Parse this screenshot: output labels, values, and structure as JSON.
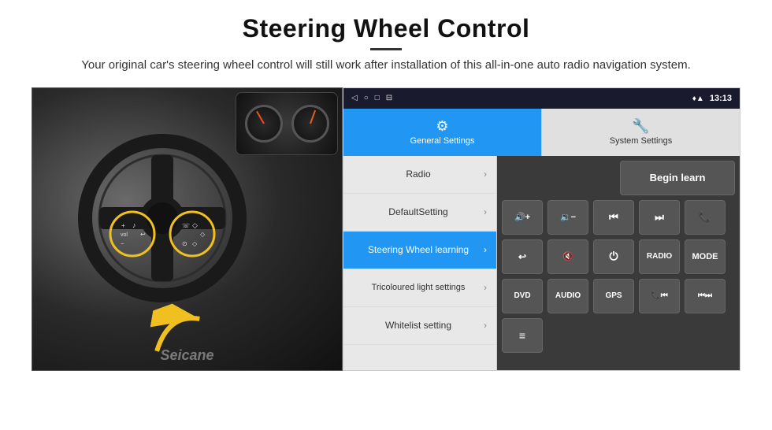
{
  "page": {
    "title": "Steering Wheel Control",
    "subtitle": "Your original car's steering wheel control will still work after installation of this all-in-one auto radio navigation system."
  },
  "status_bar": {
    "time": "13:13",
    "icons": [
      "◁",
      "○",
      "□",
      "⊟"
    ]
  },
  "tabs": [
    {
      "id": "general",
      "label": "General Settings",
      "active": true
    },
    {
      "id": "system",
      "label": "System Settings",
      "active": false
    }
  ],
  "menu": [
    {
      "label": "Radio",
      "active": false
    },
    {
      "label": "DefaultSetting",
      "active": false
    },
    {
      "label": "Steering Wheel learning",
      "active": true
    },
    {
      "label": "Tricoloured light settings",
      "active": false
    },
    {
      "label": "Whitelist setting",
      "active": false
    }
  ],
  "controls": {
    "begin_learn": "Begin learn",
    "row1": [
      "🔊+",
      "🔉−",
      "⏮",
      "⏭",
      "☎"
    ],
    "row2": [
      "↩",
      "🔇",
      "⏻",
      "RADIO",
      "MODE"
    ],
    "row3": [
      "DVD",
      "AUDIO",
      "GPS",
      "📞⏮",
      "⏮⏭"
    ],
    "row4": [
      "≡"
    ]
  },
  "watermark": "Seicane"
}
